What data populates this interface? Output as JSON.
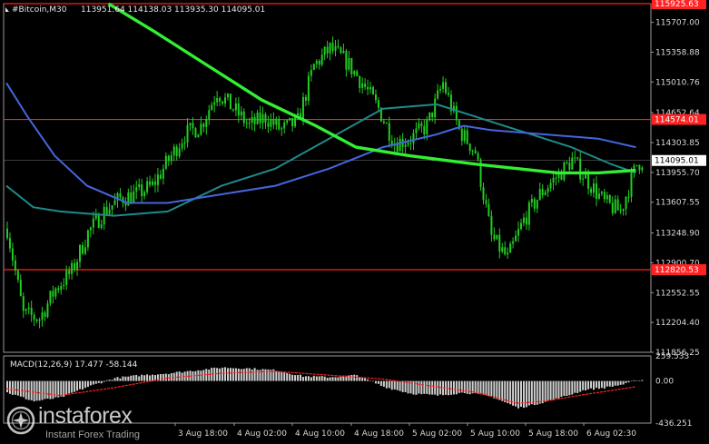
{
  "header": {
    "symbol": "#Bitcoin,M30",
    "ohlc": "113951.64 114138.03 113935.30 114095.01",
    "macd_label": "MACD(12,26,9) 17.477 -58.144"
  },
  "logo": {
    "main": "instaforex",
    "sub": "Instant Forex Trading"
  },
  "colors": {
    "background": "#000000",
    "bull": "#22cc22",
    "hline": "#ff2222",
    "ma_fast": "#1f8a8a",
    "ma_mid": "#4466dd",
    "ma_slow": "#33ee33",
    "macd_hist": "#d0d0d0",
    "macd_signal": "#ff2222"
  },
  "chart_data": {
    "type": "candlestick",
    "price_axis": {
      "min": 111856.25,
      "max": 115925.63,
      "ticks": [
        "115707.00",
        "115358.88",
        "115010.76",
        "114652.64",
        "114303.85",
        "113955.70",
        "113607.55",
        "113248.90",
        "112900.70",
        "112552.55",
        "112204.40",
        "111856.25"
      ]
    },
    "time_labels": [
      "3 Aug 18:00",
      "4 Aug 02:00",
      "4 Aug 10:00",
      "4 Aug 18:00",
      "5 Aug 02:00",
      "5 Aug 10:00",
      "5 Aug 18:00",
      "6 Aug 02:30"
    ],
    "horizontal_levels": [
      {
        "price": 115925.63,
        "label": "115925.63"
      },
      {
        "price": 114574.01,
        "label": "114574.01"
      },
      {
        "price": 112820.53,
        "label": "112820.53"
      }
    ],
    "current_price": {
      "price": 114095.01,
      "label": "114095.01"
    },
    "close_path": [
      [
        0,
        113300
      ],
      [
        6,
        112300
      ],
      [
        12,
        112250
      ],
      [
        18,
        112600
      ],
      [
        24,
        112800
      ],
      [
        30,
        113250
      ],
      [
        36,
        113500
      ],
      [
        42,
        113650
      ],
      [
        48,
        113700
      ],
      [
        54,
        113800
      ],
      [
        60,
        114100
      ],
      [
        66,
        114400
      ],
      [
        72,
        114500
      ],
      [
        78,
        114900
      ],
      [
        84,
        114700
      ],
      [
        90,
        114500
      ],
      [
        96,
        114600
      ],
      [
        102,
        114450
      ],
      [
        108,
        114550
      ],
      [
        114,
        115200
      ],
      [
        120,
        115400
      ],
      [
        126,
        115250
      ],
      [
        132,
        115000
      ],
      [
        138,
        114700
      ],
      [
        144,
        114300
      ],
      [
        150,
        114350
      ],
      [
        156,
        114500
      ],
      [
        162,
        115000
      ],
      [
        168,
        114450
      ],
      [
        174,
        114200
      ],
      [
        180,
        113200
      ],
      [
        186,
        112950
      ],
      [
        192,
        113400
      ],
      [
        198,
        113700
      ],
      [
        204,
        113900
      ],
      [
        210,
        114100
      ],
      [
        216,
        113850
      ],
      [
        222,
        113600
      ],
      [
        228,
        113500
      ],
      [
        234,
        114050
      ],
      [
        236,
        114095
      ]
    ],
    "series": [
      {
        "color": "#1f8a8a",
        "points": [
          [
            0,
            113800
          ],
          [
            10,
            113550
          ],
          [
            20,
            113500
          ],
          [
            40,
            113450
          ],
          [
            60,
            113500
          ],
          [
            80,
            113800
          ],
          [
            100,
            114000
          ],
          [
            120,
            114350
          ],
          [
            140,
            114700
          ],
          [
            160,
            114750
          ],
          [
            175,
            114600
          ],
          [
            190,
            114450
          ],
          [
            210,
            114250
          ],
          [
            225,
            114050
          ],
          [
            234,
            113950
          ]
        ]
      },
      {
        "color": "#4466dd",
        "points": [
          [
            0,
            115000
          ],
          [
            8,
            114600
          ],
          [
            18,
            114150
          ],
          [
            30,
            113800
          ],
          [
            45,
            113600
          ],
          [
            60,
            113600
          ],
          [
            80,
            113700
          ],
          [
            100,
            113800
          ],
          [
            120,
            114000
          ],
          [
            140,
            114250
          ],
          [
            160,
            114400
          ],
          [
            170,
            114500
          ],
          [
            180,
            114450
          ],
          [
            200,
            114400
          ],
          [
            220,
            114350
          ],
          [
            234,
            114250
          ]
        ]
      },
      {
        "color": "#33ee33",
        "points": [
          [
            38,
            115925
          ],
          [
            55,
            115600
          ],
          [
            75,
            115200
          ],
          [
            95,
            114800
          ],
          [
            115,
            114500
          ],
          [
            130,
            114250
          ],
          [
            150,
            114150
          ],
          [
            175,
            114050
          ],
          [
            190,
            114000
          ],
          [
            205,
            113950
          ],
          [
            220,
            113950
          ],
          [
            234,
            113980
          ]
        ]
      }
    ],
    "macd": {
      "ymin": -436.251,
      "ymax": 259.533,
      "ticks": [
        "259.533",
        "0.00",
        "-436.251"
      ],
      "histogram": [
        [
          0,
          -120
        ],
        [
          10,
          -210
        ],
        [
          20,
          -170
        ],
        [
          30,
          -60
        ],
        [
          40,
          30
        ],
        [
          50,
          60
        ],
        [
          60,
          80
        ],
        [
          70,
          110
        ],
        [
          80,
          140
        ],
        [
          90,
          130
        ],
        [
          100,
          110
        ],
        [
          110,
          50
        ],
        [
          120,
          40
        ],
        [
          130,
          60
        ],
        [
          140,
          -60
        ],
        [
          150,
          -130
        ],
        [
          160,
          -150
        ],
        [
          170,
          -120
        ],
        [
          180,
          -160
        ],
        [
          190,
          -280
        ],
        [
          195,
          -250
        ],
        [
          205,
          -180
        ],
        [
          215,
          -90
        ],
        [
          222,
          -70
        ],
        [
          230,
          -30
        ],
        [
          234,
          10
        ]
      ],
      "signal": [
        [
          0,
          -80
        ],
        [
          20,
          -150
        ],
        [
          40,
          -70
        ],
        [
          60,
          30
        ],
        [
          80,
          80
        ],
        [
          100,
          100
        ],
        [
          120,
          60
        ],
        [
          140,
          20
        ],
        [
          160,
          -60
        ],
        [
          175,
          -120
        ],
        [
          190,
          -230
        ],
        [
          200,
          -210
        ],
        [
          215,
          -140
        ],
        [
          234,
          -60
        ]
      ]
    }
  }
}
